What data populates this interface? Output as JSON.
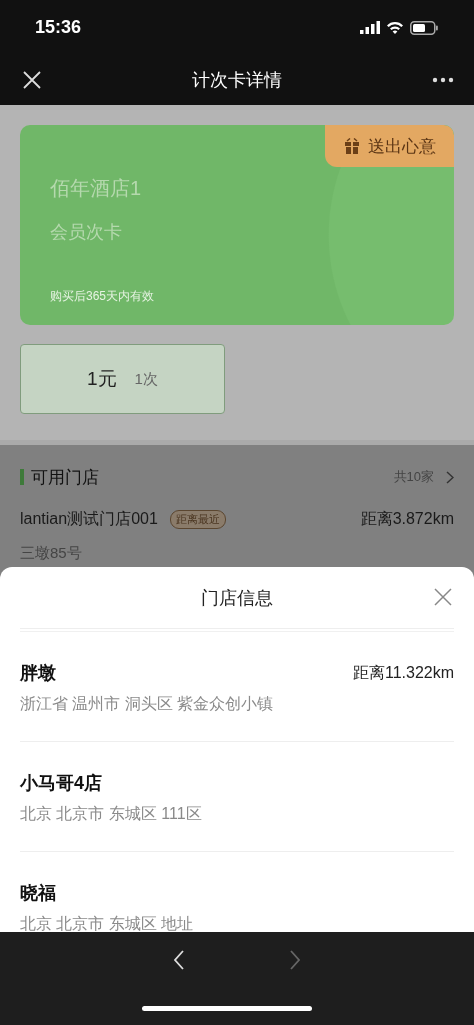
{
  "status_bar": {
    "time": "15:36"
  },
  "nav": {
    "title": "计次卡详情"
  },
  "card": {
    "store_name": "佰年酒店1",
    "card_type": "会员次卡",
    "validity": "购买后365天内有效",
    "gift_button": "送出心意"
  },
  "price_options": [
    {
      "price": "1元",
      "count": "1次",
      "selected": true
    }
  ],
  "stores_section": {
    "title": "可用门店",
    "count": "共10家",
    "nearest": {
      "name": "lantian测试门店001",
      "tag": "距离最近",
      "distance": "距离3.872km",
      "address": "三墩85号"
    }
  },
  "sheet": {
    "title": "门店信息",
    "stores": [
      {
        "name": "胖墩",
        "distance": "距离11.322km",
        "address": "浙江省 温州市 洞头区 紫金众创小镇"
      },
      {
        "name": "小马哥4店",
        "address": "北京 北京市 东城区 111区"
      },
      {
        "name": "晓福",
        "address": "北京 北京市 东城区 地址"
      }
    ]
  },
  "browser_bar": {
    "back_disabled": false,
    "forward_disabled": true
  }
}
